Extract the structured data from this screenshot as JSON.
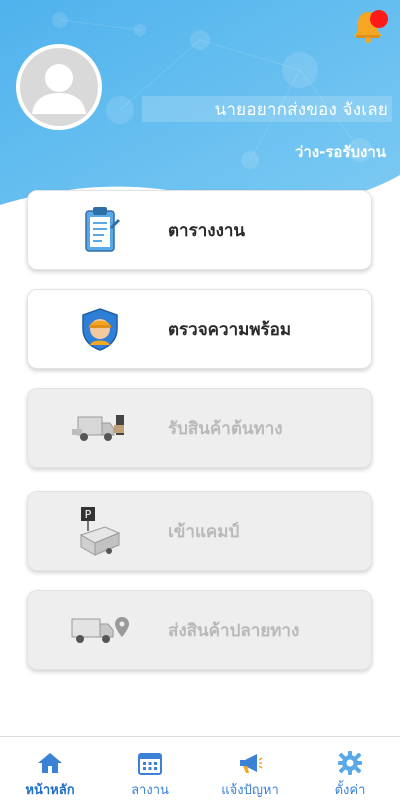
{
  "header": {
    "user_name": "นายอยากส่งของ จังเลย",
    "status": "ว่าง-รอรับงาน"
  },
  "menu": {
    "items": [
      {
        "label": "ตารางงาน",
        "enabled": true,
        "icon": "clipboard-icon"
      },
      {
        "label": "ตรวจความพร้อม",
        "enabled": true,
        "icon": "worker-shield-icon"
      },
      {
        "label": "รับสินค้าต้นทาง",
        "enabled": false,
        "icon": "truck-loading-icon"
      },
      {
        "label": "เข้าแคมป์",
        "enabled": false,
        "icon": "truck-parking-icon"
      },
      {
        "label": "ส่งสินค้าปลายทาง",
        "enabled": false,
        "icon": "truck-location-icon"
      }
    ]
  },
  "nav": {
    "items": [
      {
        "label": "หน้าหลัก",
        "icon": "home-icon",
        "current": true
      },
      {
        "label": "ลางาน",
        "icon": "calendar-icon",
        "current": false
      },
      {
        "label": "แจ้งปัญหา",
        "icon": "megaphone-icon",
        "current": false
      },
      {
        "label": "ตั้งค่า",
        "icon": "gear-icon",
        "current": false
      }
    ]
  },
  "colors": {
    "header_blue": "#5bb8ee",
    "accent_blue": "#3b82d6",
    "disabled_card": "#eeeeee",
    "notification_dot": "#ff1a1a"
  }
}
